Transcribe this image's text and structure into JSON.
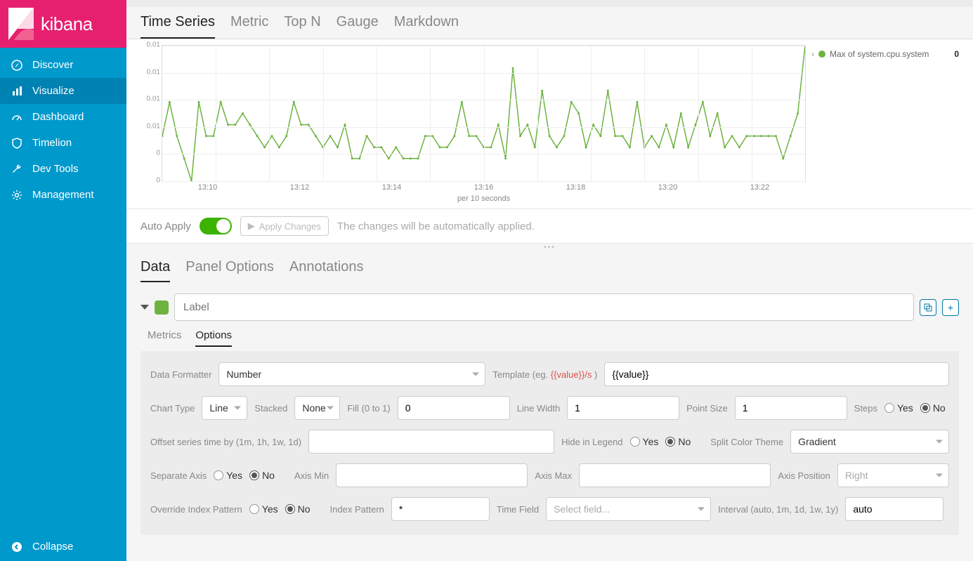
{
  "brand": "kibana",
  "sidebar": {
    "items": [
      {
        "label": "Discover"
      },
      {
        "label": "Visualize"
      },
      {
        "label": "Dashboard"
      },
      {
        "label": "Timelion"
      },
      {
        "label": "Dev Tools"
      },
      {
        "label": "Management"
      }
    ],
    "collapse": "Collapse"
  },
  "vis_tabs": [
    "Time Series",
    "Metric",
    "Top N",
    "Gauge",
    "Markdown"
  ],
  "chart_data": {
    "type": "line",
    "title": "",
    "xlabel": "per 10 seconds",
    "ylabel": "",
    "ylim": [
      0,
      0.012
    ],
    "yticks": [
      0,
      0,
      0.01,
      0.01,
      0.01,
      0.01
    ],
    "xticks": [
      "13:10",
      "13:12",
      "13:14",
      "13:16",
      "13:18",
      "13:20",
      "13:22"
    ],
    "series": [
      {
        "name": "Max of system.cpu.system",
        "color": "#6db33f",
        "latest": 0,
        "values": [
          0.004,
          0.007,
          0.004,
          0.002,
          0,
          0.007,
          0.004,
          0.004,
          0.007,
          0.005,
          0.005,
          0.006,
          0.005,
          0.004,
          0.003,
          0.004,
          0.003,
          0.004,
          0.007,
          0.005,
          0.005,
          0.004,
          0.003,
          0.004,
          0.003,
          0.005,
          0.002,
          0.002,
          0.004,
          0.003,
          0.003,
          0.002,
          0.003,
          0.002,
          0.002,
          0.002,
          0.004,
          0.004,
          0.003,
          0.003,
          0.004,
          0.007,
          0.004,
          0.004,
          0.003,
          0.003,
          0.005,
          0.002,
          0.01,
          0.004,
          0.005,
          0.003,
          0.008,
          0.004,
          0.003,
          0.004,
          0.007,
          0.006,
          0.003,
          0.005,
          0.004,
          0.008,
          0.004,
          0.004,
          0.003,
          0.007,
          0.003,
          0.004,
          0.003,
          0.005,
          0.003,
          0.006,
          0.003,
          0.005,
          0.007,
          0.004,
          0.006,
          0.003,
          0.004,
          0.003,
          0.004,
          0.004,
          0.004,
          0.004,
          0.004,
          0.002,
          0.004,
          0.006,
          0.012
        ]
      }
    ]
  },
  "apply": {
    "label": "Auto Apply",
    "button": "Apply Changes",
    "hint": "The changes will be automatically applied."
  },
  "cfg_tabs": [
    "Data",
    "Panel Options",
    "Annotations"
  ],
  "series": {
    "label_placeholder": "Label"
  },
  "sub_tabs": [
    "Metrics",
    "Options"
  ],
  "options": {
    "data_formatter": {
      "label": "Data Formatter",
      "value": "Number"
    },
    "template": {
      "label_prefix": "Template (eg. ",
      "label_eg": "{{value}}/s",
      "label_suffix": " )",
      "value": "{{value}}"
    },
    "chart_type": {
      "label": "Chart Type",
      "value": "Line"
    },
    "stacked": {
      "label": "Stacked",
      "value": "None"
    },
    "fill": {
      "label": "Fill (0 to 1)",
      "value": "0"
    },
    "line_width": {
      "label": "Line Width",
      "value": "1"
    },
    "point_size": {
      "label": "Point Size",
      "value": "1"
    },
    "steps": {
      "label": "Steps",
      "value": "No",
      "yes": "Yes",
      "no": "No"
    },
    "offset": {
      "label": "Offset series time by (1m, 1h, 1w, 1d)",
      "value": ""
    },
    "hide_legend": {
      "label": "Hide in Legend",
      "value": "No",
      "yes": "Yes",
      "no": "No"
    },
    "split_color": {
      "label": "Split Color Theme",
      "value": "Gradient"
    },
    "separate_axis": {
      "label": "Separate Axis",
      "value": "No",
      "yes": "Yes",
      "no": "No"
    },
    "axis_min": {
      "label": "Axis Min",
      "value": ""
    },
    "axis_max": {
      "label": "Axis Max",
      "value": ""
    },
    "axis_position": {
      "label": "Axis Position",
      "value": "Right"
    },
    "override_idx": {
      "label": "Override Index Pattern",
      "value": "No",
      "yes": "Yes",
      "no": "No"
    },
    "index_pattern": {
      "label": "Index Pattern",
      "value": "*"
    },
    "time_field": {
      "label": "Time Field",
      "placeholder": "Select field..."
    },
    "interval": {
      "label": "Interval (auto, 1m, 1d, 1w, 1y)",
      "value": "auto"
    }
  }
}
